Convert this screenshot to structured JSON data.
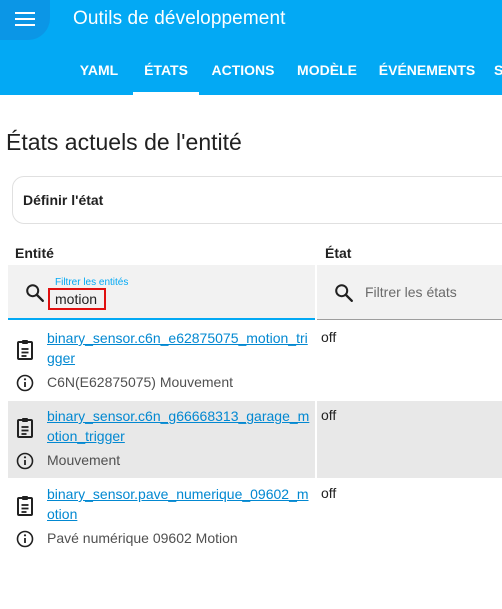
{
  "header": {
    "title": "Outils de développement",
    "menu_icon": "hamburger-menu-icon",
    "tabs": [
      {
        "label": "YAML"
      },
      {
        "label": "ÉTATS"
      },
      {
        "label": "ACTIONS"
      },
      {
        "label": "MODÈLE"
      },
      {
        "label": "ÉVÉNEMENTS"
      },
      {
        "label": "S"
      }
    ],
    "active_tab": "ÉTATS"
  },
  "main": {
    "title": "États actuels de l'entité",
    "set_state_label": "Définir l'état",
    "columns": {
      "entity": "Entité",
      "state": "État"
    },
    "entity_filter": {
      "label": "Filtrer les entités",
      "value": "motion"
    },
    "state_filter": {
      "placeholder": "Filtrer les états"
    },
    "rows": [
      {
        "entity_id": "binary_sensor.c6n_e62875075_motion_trigger",
        "friendly_name": "C6N(E62875075) Mouvement",
        "state": "off"
      },
      {
        "entity_id": "binary_sensor.c6n_g66668313_garage_motion_trigger",
        "friendly_name": "Mouvement",
        "state": "off"
      },
      {
        "entity_id": "binary_sensor.pave_numerique_09602_motion",
        "friendly_name": "Pavé numérique 09602 Motion",
        "state": "off"
      }
    ]
  },
  "colors": {
    "primary": "#03a9f4",
    "link": "#0288d1",
    "highlight_box": "#e01010"
  }
}
